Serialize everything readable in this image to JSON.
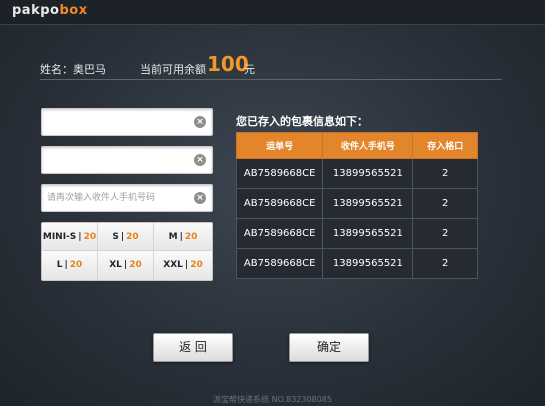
{
  "logo": {
    "part1": "pakpo",
    "part2": "box"
  },
  "user": {
    "name_label": "姓名：奥巴马",
    "balance_label": "当前可用余额",
    "balance": "100",
    "unit": "元"
  },
  "fields": [
    {
      "value": "",
      "placeholder": ""
    },
    {
      "value": "",
      "placeholder": ""
    },
    {
      "value": "",
      "placeholder": "请再次输入收件人手机号码"
    }
  ],
  "sizes": [
    {
      "label": "MINI-S",
      "count": "20"
    },
    {
      "label": "S",
      "count": "20"
    },
    {
      "label": "M",
      "count": "20"
    },
    {
      "label": "L",
      "count": "20"
    },
    {
      "label": "XL",
      "count": "20"
    },
    {
      "label": "XXL",
      "count": "20"
    }
  ],
  "table": {
    "title": "您已存入的包裹信息如下：",
    "headers": [
      "运单号",
      "收件人手机号",
      "存入格口"
    ],
    "rows": [
      [
        "AB7589668CE",
        "13899565521",
        "2"
      ],
      [
        "AB7589668CE",
        "13899565521",
        "2"
      ],
      [
        "AB7589668CE",
        "13899565521",
        "2"
      ],
      [
        "AB7589668CE",
        "13899565521",
        "2"
      ]
    ]
  },
  "buttons": {
    "back": "返 回",
    "confirm": "确定"
  },
  "footer": "派宝帮快递系统 NO.832308085",
  "colors": {
    "accent": "#e3852a",
    "balance": "#f39a26"
  }
}
